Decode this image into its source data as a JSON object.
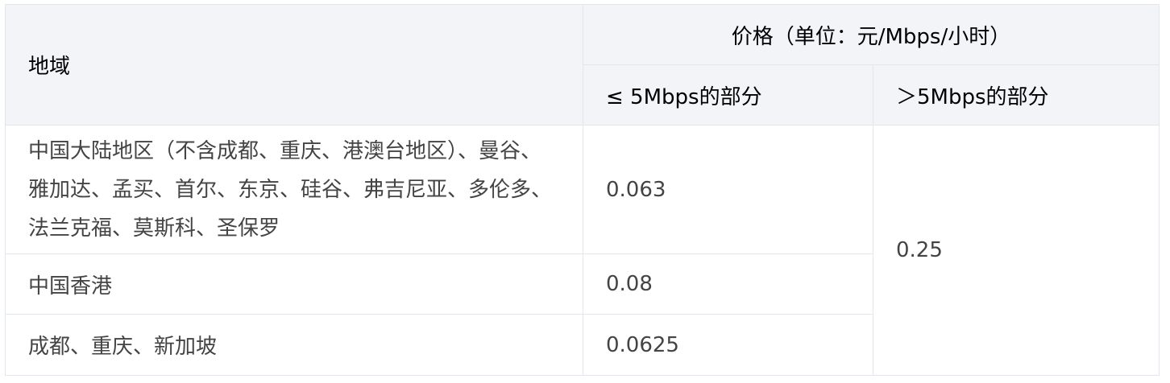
{
  "table": {
    "header": {
      "region": "地域",
      "price_group": "价格（单位：元/Mbps/小时）",
      "le_5": "≤ 5Mbps的部分",
      "gt_5": "＞5Mbps的部分"
    },
    "rows": [
      {
        "region": "中国大陆地区（不含成都、重庆、港澳台地区）、曼谷、雅加达、孟买、首尔、东京、硅谷、弗吉尼亚、多伦多、法兰克福、莫斯科、圣保罗",
        "le_5": "0.063"
      },
      {
        "region": "中国香港",
        "le_5": "0.08"
      },
      {
        "region": "成都、重庆、新加坡",
        "le_5": "0.0625"
      }
    ],
    "gt_5_shared": "0.25"
  }
}
